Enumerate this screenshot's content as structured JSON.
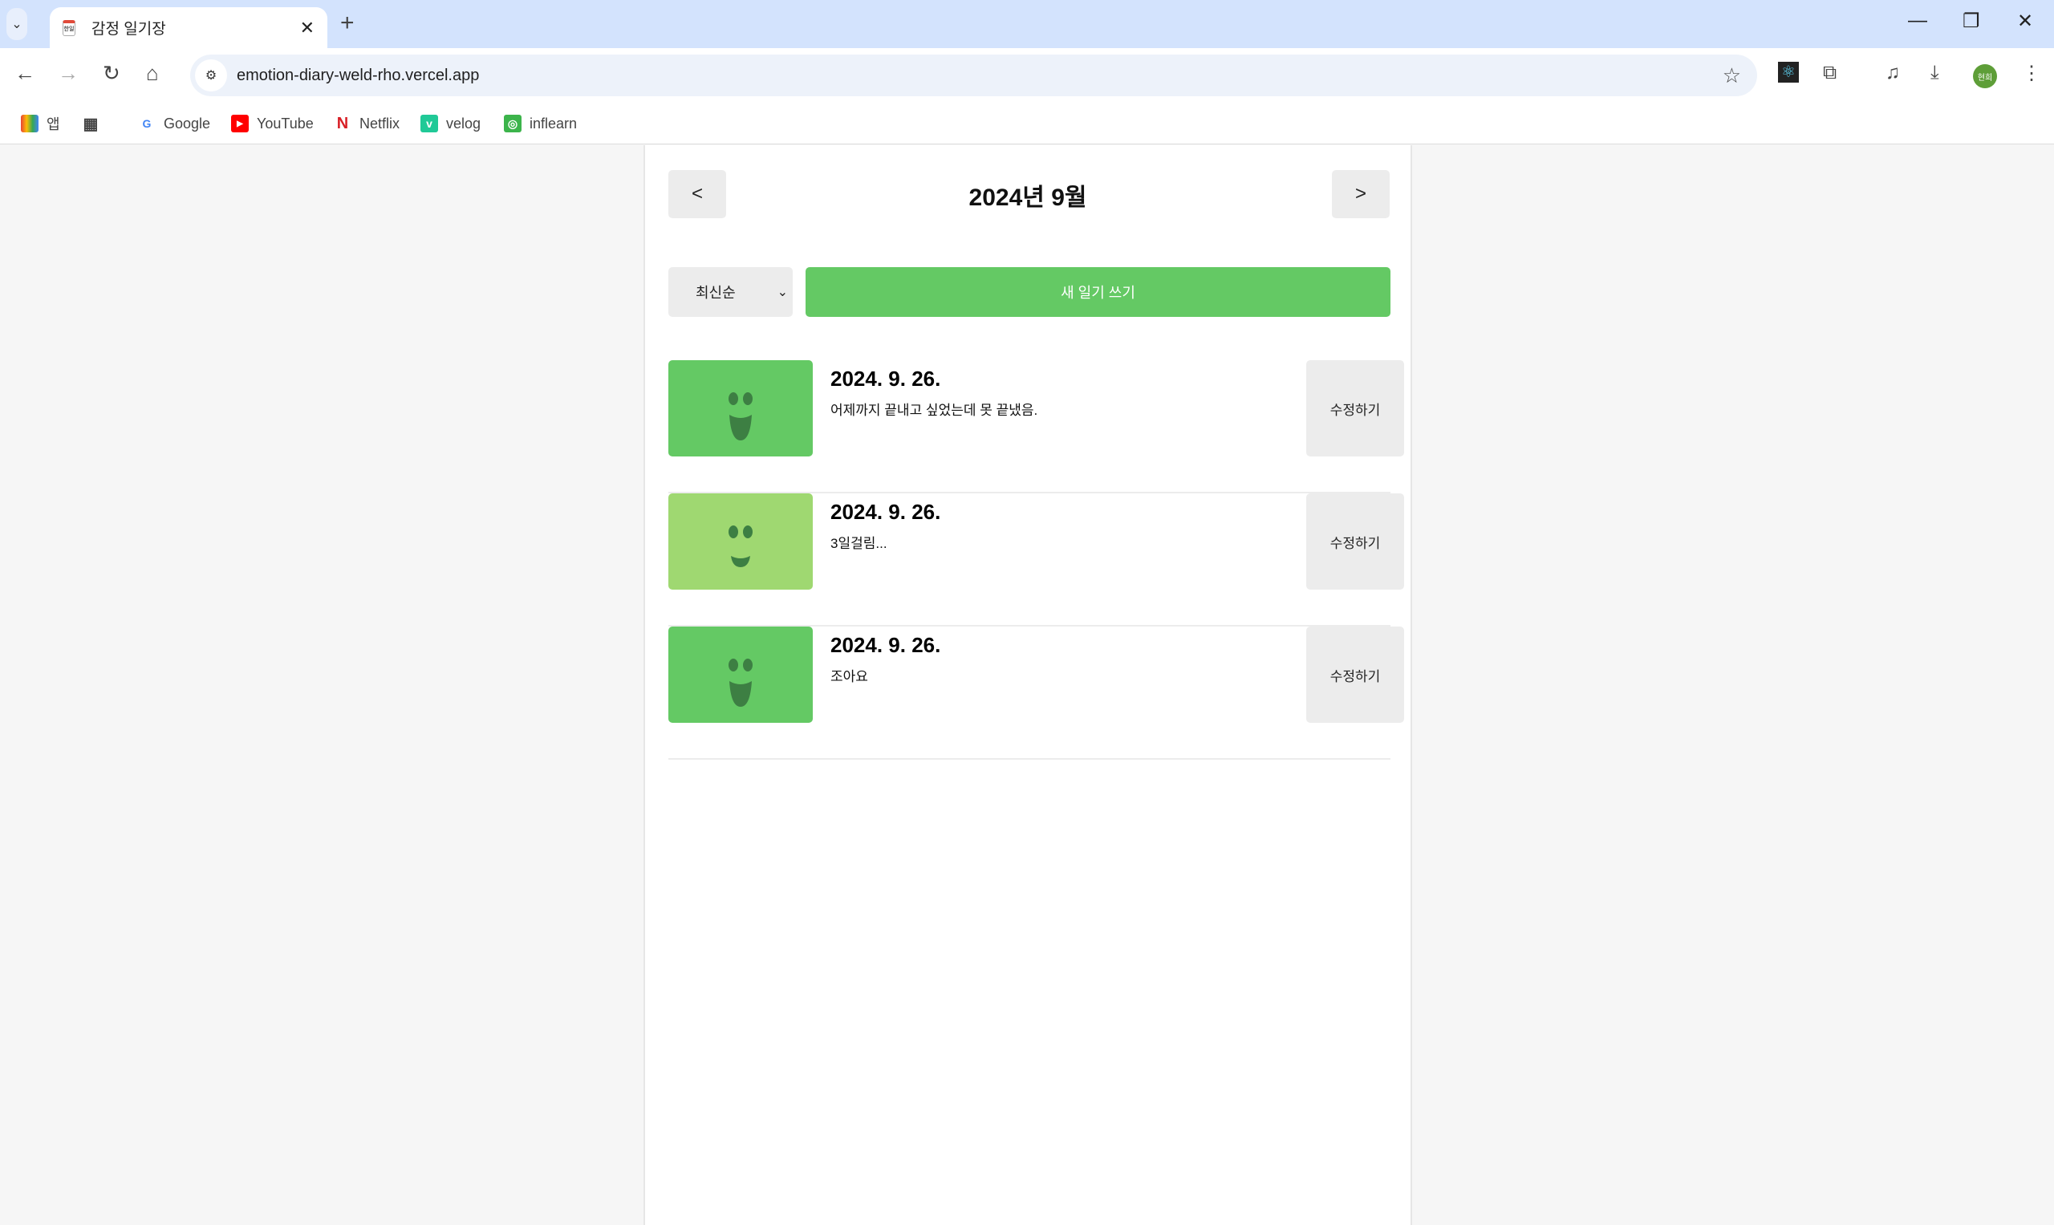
{
  "browser": {
    "tab_title": "감정 일기장",
    "favicon_text": "한일",
    "url": "emotion-diary-weld-rho.vercel.app",
    "profile": "현희",
    "bookmarks": [
      {
        "label": "앱",
        "icon": "apps-grid-icon"
      },
      {
        "label": "",
        "icon": "tab-groups-icon"
      },
      {
        "label": "Google",
        "icon": "google-icon",
        "color": "#4285f4"
      },
      {
        "label": "YouTube",
        "icon": "youtube-icon",
        "color": "#ff0000"
      },
      {
        "label": "Netflix",
        "icon": "netflix-icon",
        "color": "#d81f26"
      },
      {
        "label": "velog",
        "icon": "velog-icon",
        "color": "#20c997"
      },
      {
        "label": "inflearn",
        "icon": "inflearn-icon",
        "color": "#3cb44b"
      }
    ]
  },
  "header": {
    "title": "2024년 9월",
    "prev": "<",
    "next": ">"
  },
  "controls": {
    "sort_selected": "최신순",
    "new_button": "새 일기 쓰기"
  },
  "colors": {
    "accent": "#64c964",
    "emotion1": "#64c964",
    "emotion2": "#9fd871",
    "face": "#3d7f43"
  },
  "diary": [
    {
      "date": "2024. 9. 26.",
      "content": "어제까지 끝내고 싶었는데 못 끝냈음.",
      "emotion_color": "#64c964",
      "face": "big-smile",
      "edit": "수정하기"
    },
    {
      "date": "2024. 9. 26.",
      "content": "3일걸림...",
      "emotion_color": "#9fd871",
      "face": "smile",
      "edit": "수정하기"
    },
    {
      "date": "2024. 9. 26.",
      "content": "조아요",
      "emotion_color": "#64c964",
      "face": "big-smile",
      "edit": "수정하기"
    }
  ]
}
